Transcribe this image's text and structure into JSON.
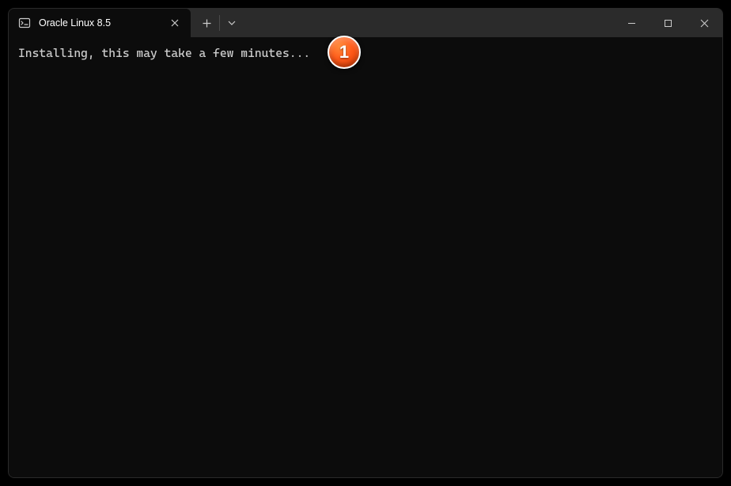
{
  "tab": {
    "title": "Oracle Linux 8.5"
  },
  "terminal": {
    "line1": "Installing, this may take a few minutes..."
  },
  "annotation": {
    "number": "1"
  }
}
